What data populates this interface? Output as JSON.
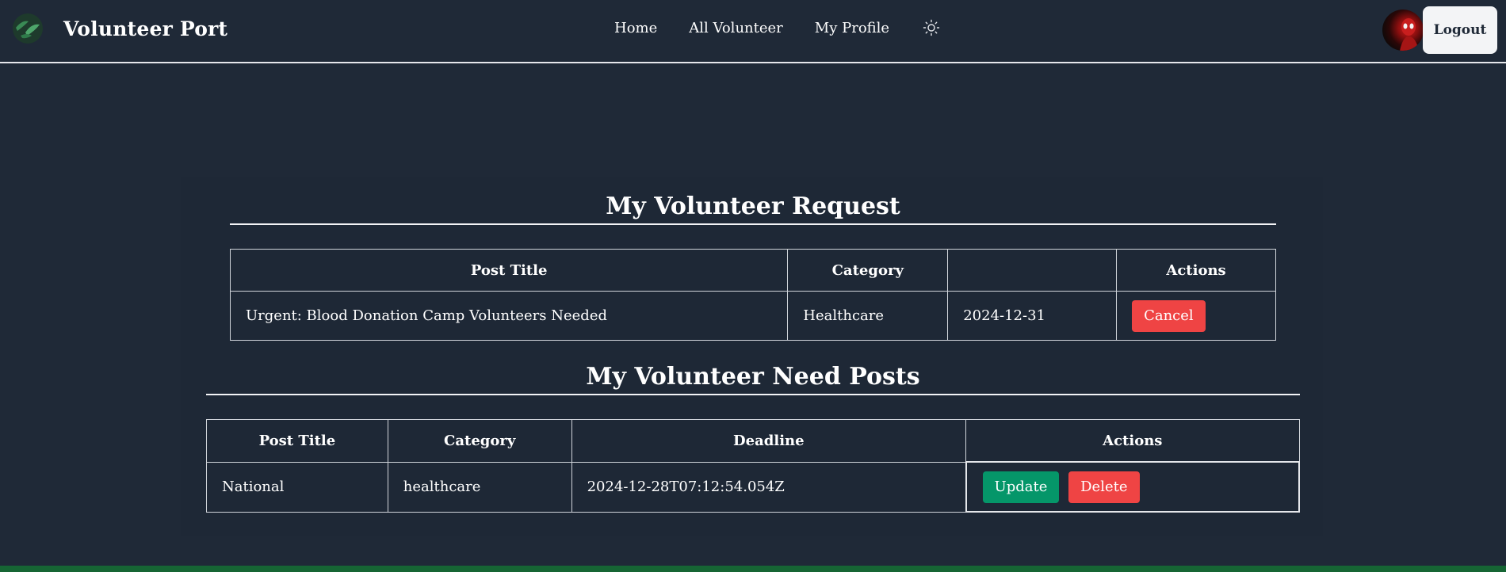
{
  "navbar": {
    "brand": "Volunteer Port",
    "links": [
      "Home",
      "All Volunteer",
      "My Profile"
    ],
    "logout_label": "Logout"
  },
  "requests": {
    "title": "My Volunteer Request",
    "headers": [
      "Post Title",
      "Category",
      "",
      "Actions"
    ],
    "rows": [
      {
        "title": "Urgent: Blood Donation Camp Volunteers Needed",
        "category": "Healthcare",
        "date": "2024-12-31",
        "action": "Cancel"
      }
    ]
  },
  "posts": {
    "title": "My Volunteer Need Posts",
    "headers": [
      "Post Title",
      "Category",
      "Deadline",
      "Actions"
    ],
    "rows": [
      {
        "title": "National",
        "category": "healthcare",
        "deadline": "2024-12-28T07:12:54.054Z",
        "update": "Update",
        "delete": "Delete"
      }
    ]
  },
  "colors": {
    "background": "#1f2937",
    "danger": "#ef4444",
    "success": "#059669",
    "footer": "#166534"
  },
  "icons": [
    "logo-icon",
    "sun-icon"
  ]
}
